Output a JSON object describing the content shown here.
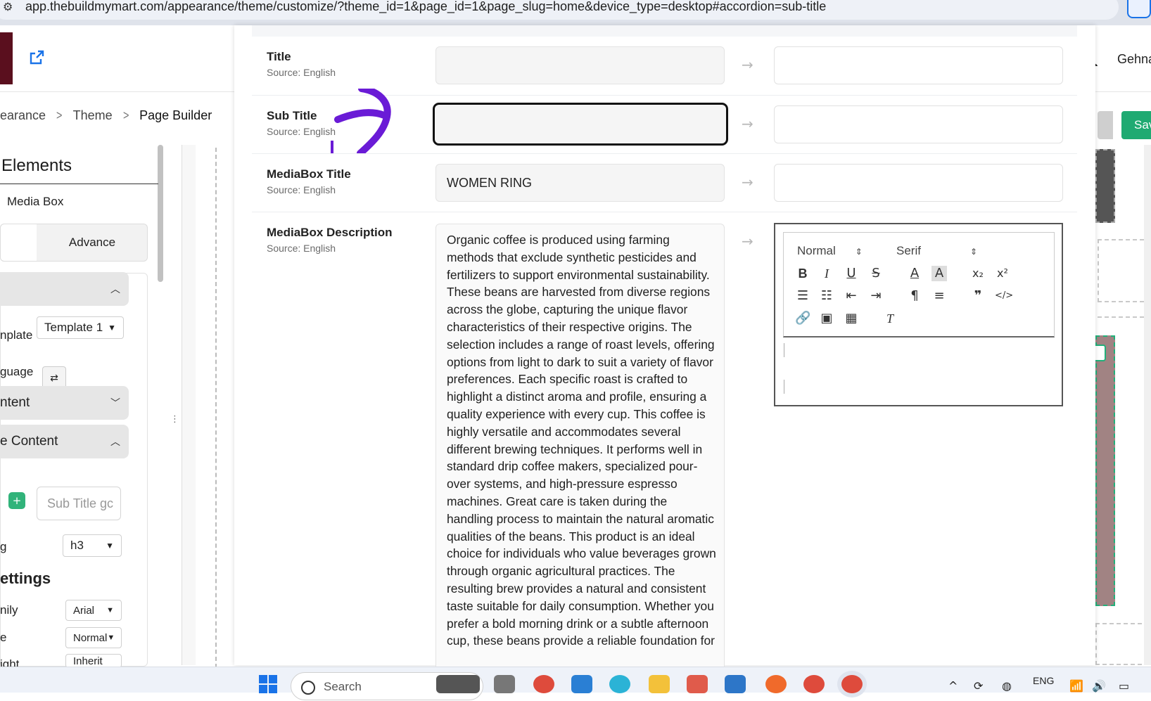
{
  "browser": {
    "url": "app.thebuildmymart.com/appearance/theme/customize/?theme_id=1&page_id=1&page_slug=home&device_type=desktop#accordion=sub-title"
  },
  "header": {
    "user_name": "Gehna"
  },
  "breadcrumb": {
    "item1": "earance",
    "item2": "Theme",
    "item3": "Page Builder"
  },
  "top_actions": {
    "save_label": "Sav"
  },
  "left_panel": {
    "title": "Elements",
    "element_name": "Media Box",
    "tab_advance": "Advance",
    "template_label": "nplate",
    "template_value": "Template 1",
    "language_label": "guage",
    "content_label": "ntent",
    "title_content_label": "e Content",
    "subtitle_placeholder": "Sub Title gc",
    "tag_label": "g",
    "tag_value": "h3",
    "settings_label": "ettings",
    "font_family_label": "nily",
    "font_family_value": "Arial",
    "font_style_label": "e",
    "font_style_value": "Normal",
    "font_weight_label": "ight",
    "font_weight_value": "Inherit"
  },
  "modal": {
    "rows": [
      {
        "label": "Title",
        "source": "Source: English",
        "value": "",
        "translation": ""
      },
      {
        "label": "Sub Title",
        "source": "Source: English",
        "value": "",
        "translation": ""
      },
      {
        "label": "MediaBox Title",
        "source": "Source: English",
        "value": "WOMEN RING",
        "translation": ""
      },
      {
        "label": "MediaBox Description",
        "source": "Source: English",
        "value": "Organic coffee is produced using farming methods that exclude synthetic pesticides and fertilizers to support environmental sustainability. These beans are harvested from diverse regions across the globe, capturing the unique flavor characteristics of their respective origins. The selection includes a range of roast levels, offering options from light to dark to suit a variety of flavor preferences. Each specific roast is crafted to highlight a distinct aroma and profile, ensuring a quality experience with every cup. This coffee is highly versatile and accommodates several different brewing techniques. It performs well in standard drip coffee makers, specialized pour-over systems, and high-pressure espresso machines. Great care is taken during the handling process to maintain the natural aromatic qualities of the beans. This product is an ideal choice for individuals who value beverages grown through organic agricultural practices. The resulting brew provides a natural and consistent taste suitable for daily consumption. Whether you prefer a bold morning drink or a subtle afternoon cup, these beans provide a reliable foundation for"
      }
    ],
    "editor": {
      "format_select": "Normal",
      "font_select": "Serif"
    }
  },
  "taskbar": {
    "search_placeholder": "Search",
    "language": "ENG"
  },
  "colors": {
    "accent_green": "#1faa72",
    "annotation_purple": "#6a1bd6",
    "logo_maroon": "#5a0f1e"
  }
}
